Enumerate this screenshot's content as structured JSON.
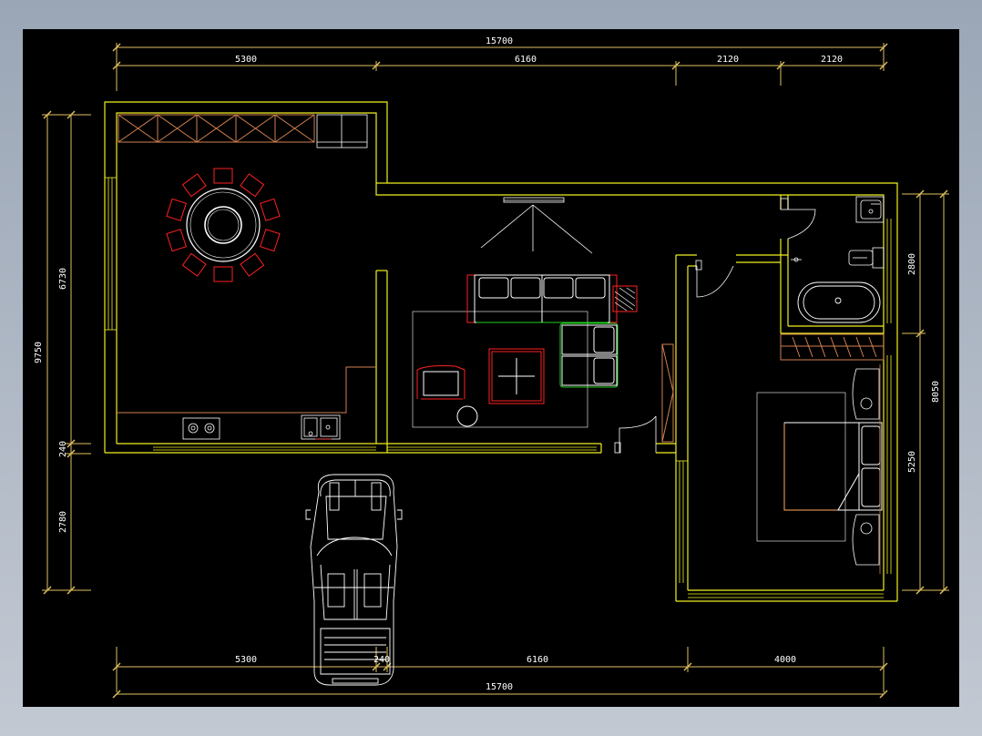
{
  "colors": {
    "background": "#000000",
    "window_frame": "#9aa6b6",
    "wall": "#f0f020",
    "dimension": "#e0c060",
    "dimension_text": "#ffffff",
    "furniture_red": "#ff2020",
    "furniture_white": "#ffffff",
    "furniture_orange": "#d08050",
    "furniture_green": "#20d020",
    "fixture_grey": "#c0c0c0"
  },
  "dimensions": {
    "top": {
      "overall": "15700",
      "segments": [
        "5300",
        "6160",
        "2120",
        "2120"
      ]
    },
    "bottom": {
      "overall": "15700",
      "segments": [
        "5300",
        "240",
        "6160",
        "4000"
      ]
    },
    "left": {
      "overall": "9750",
      "segments": [
        "6730",
        "240",
        "2780"
      ]
    },
    "right": {
      "segments": [
        "2800",
        "5250",
        "8050"
      ]
    }
  },
  "icons": [
    "dining-table-icon",
    "sofa-icon",
    "armchair-icon",
    "bathtub-icon",
    "toilet-icon",
    "bed-icon",
    "car-icon",
    "stove-icon",
    "sink-icon",
    "door-swing-icon"
  ]
}
